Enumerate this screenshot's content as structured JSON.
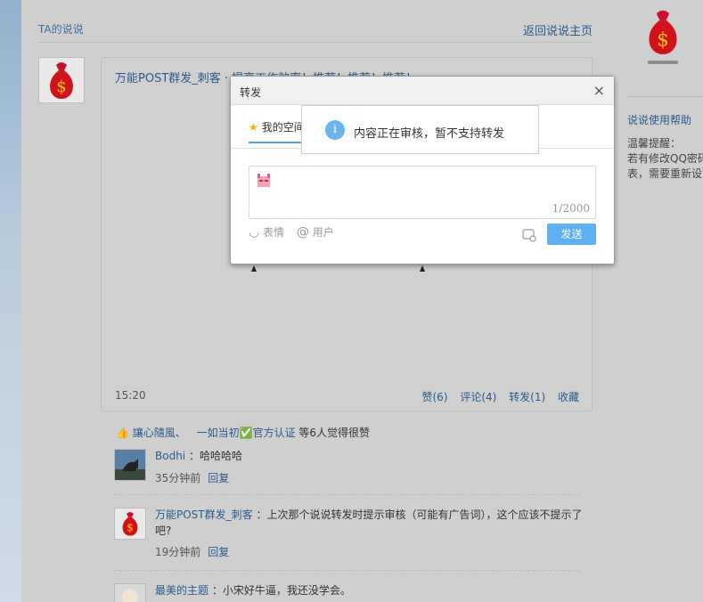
{
  "header": {
    "title": "TA的说说",
    "back_link": "返回说说主页"
  },
  "post": {
    "title": "万能POST群发_刺客 · 提高工作效率！推荐！推荐！推荐！",
    "time": "15:20",
    "actions": {
      "like": "赞(6)",
      "comment": "评论(4)",
      "forward": "转发(1)",
      "favorite": "收藏"
    }
  },
  "likes": {
    "user1": "讓心隨風、",
    "user2": "一如当初✅官方认证",
    "suffix": "等6人觉得很赞"
  },
  "comments": [
    {
      "name": "Bodhi",
      "text": "：哈哈哈哈",
      "time": "35分钟前",
      "reply": "回复"
    },
    {
      "name": "万能POST群发_刺客",
      "text": "：上次那个说说转发时提示审核（可能有广告词），这个应该不提示了吧?",
      "time": "19分钟前",
      "reply": "回复"
    },
    {
      "name": "最美的主题",
      "text": "：小宋好牛逼，我还没学会。"
    }
  ],
  "sidebar": {
    "help_title": "说说使用帮助",
    "tip_label": "温馨提醒：",
    "tip_line1": "若有修改QQ密码",
    "tip_line2": "表，需要重新设"
  },
  "modal": {
    "title": "转发",
    "close": "×",
    "tab_label": "我的空间",
    "counter": "1/2000",
    "emoji_label": "表情",
    "user_label": "用户",
    "send_label": "发送"
  },
  "toast": {
    "message": "内容正在审核，暂不支持转发",
    "icon": "i"
  },
  "colors": {
    "accent": "#5eb0f0",
    "link": "#2c5a8e",
    "info": "#6cb4f0"
  }
}
